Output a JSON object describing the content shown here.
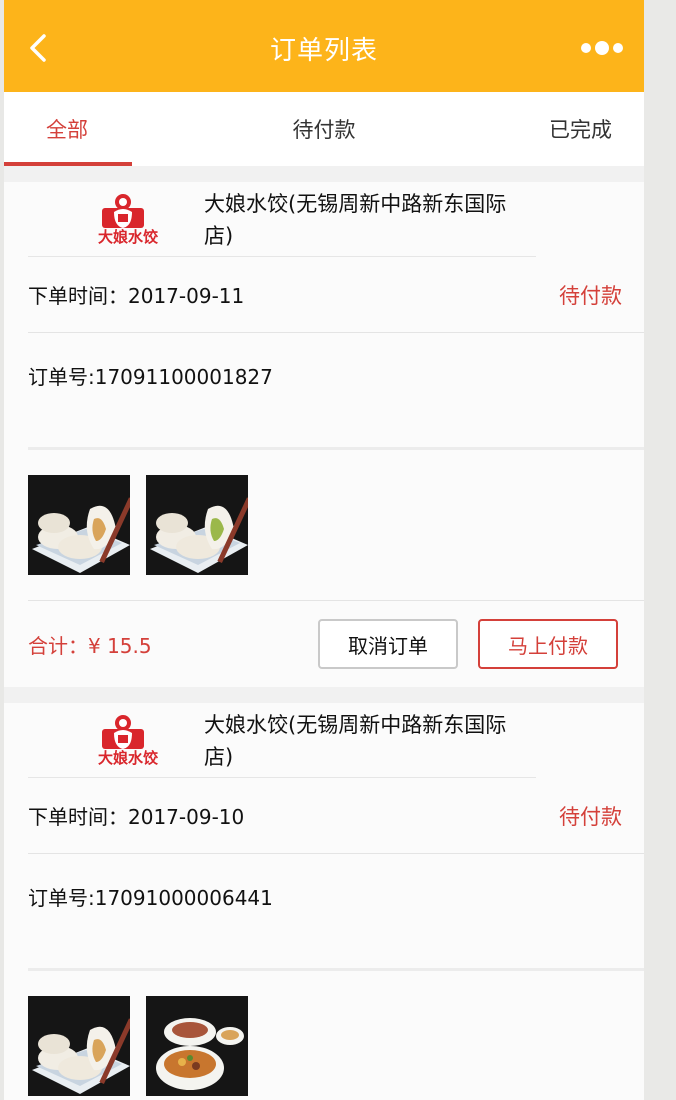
{
  "header": {
    "title": "订单列表",
    "back_icon": "chevron-left-icon",
    "more_icon": "more-dots-icon",
    "color": "#fdb41a"
  },
  "tabs": [
    {
      "label": "全部",
      "active": true
    },
    {
      "label": "待付款",
      "active": false
    },
    {
      "label": "已完成",
      "active": false
    }
  ],
  "accent": "#d4403a",
  "orders": [
    {
      "shop_name": "大娘水饺(无锡周新中路新东国际店)",
      "shop_logo": "dumpling-restaurant-logo",
      "logo_text": "大娘水饺",
      "time_label": "下单时间：",
      "time": "2017-09-11",
      "status": "待付款",
      "order_no": "订单号:17091100001827",
      "thumbs": [
        "dumplings-image",
        "dumplings-image"
      ],
      "total": "合计：¥ 15.5",
      "cancel_label": "取消订单",
      "pay_label": "马上付款"
    },
    {
      "shop_name": "大娘水饺(无锡周新中路新东国际店)",
      "shop_logo": "dumpling-restaurant-logo",
      "logo_text": "大娘水饺",
      "time_label": "下单时间：",
      "time": "2017-09-10",
      "status": "待付款",
      "order_no": "订单号:17091000006441",
      "thumbs": [
        "dumplings-image",
        "noodle-soup-image"
      ]
    }
  ]
}
